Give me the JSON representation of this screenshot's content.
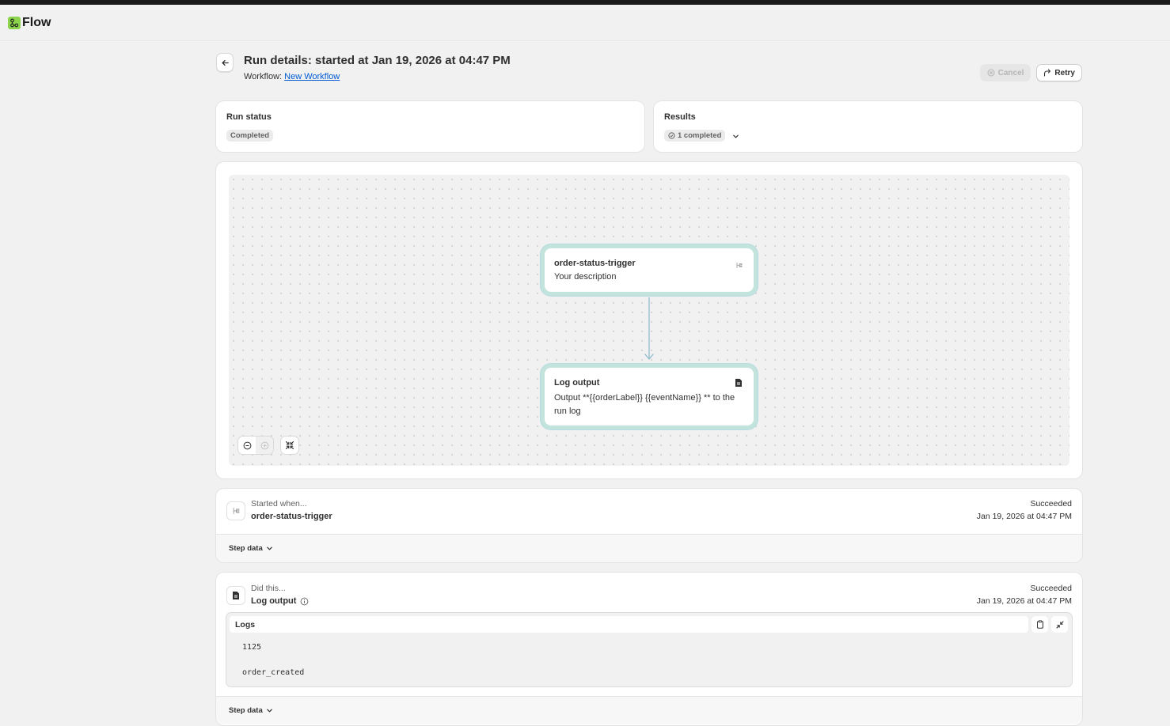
{
  "app": {
    "title": "Flow"
  },
  "header": {
    "title": "Run details: started at Jan 19, 2026 at 04:47 PM",
    "workflow_prefix": "Workflow:",
    "workflow_link": "New Workflow",
    "cancel_label": "Cancel",
    "retry_label": "Retry"
  },
  "run_status": {
    "title": "Run status",
    "badge": "Completed"
  },
  "results": {
    "title": "Results",
    "badge": "1 completed"
  },
  "canvas": {
    "trigger_node": {
      "title": "order-status-trigger",
      "description": "Your description",
      "icon": "trigger-icon"
    },
    "action_node": {
      "title": "Log output",
      "description": "Output **{{orderLabel}} {{eventName}} ** to the run log",
      "icon": "document-icon"
    }
  },
  "steps": [
    {
      "kicker": "Started when...",
      "name": "order-status-trigger",
      "status": "Succeeded",
      "date": "Jan 19, 2026 at 04:47 PM",
      "step_data_label": "Step data"
    },
    {
      "kicker": "Did this...",
      "name": "Log output",
      "status": "Succeeded",
      "date": "Jan 19, 2026 at 04:47 PM",
      "step_data_label": "Step data",
      "logs": {
        "title": "Logs",
        "lines": [
          "1125",
          "order_created"
        ]
      }
    }
  ],
  "colors": {
    "accent_link": "#005bd3",
    "node_glow": "#c2e4dd",
    "connector": "#8fbccc",
    "app_logo": "#8bd34a"
  }
}
